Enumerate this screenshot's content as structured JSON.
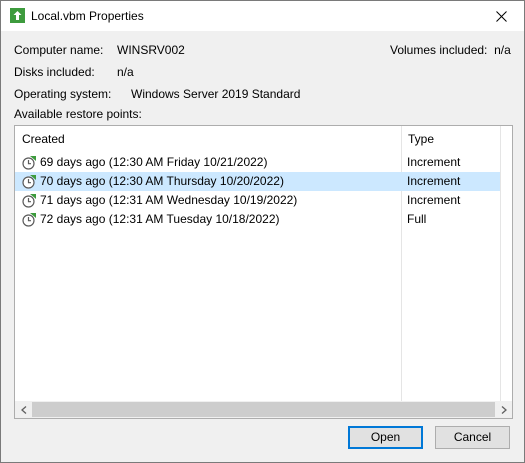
{
  "window": {
    "title": "Local.vbm Properties"
  },
  "info": {
    "computer_name_label": "Computer name:",
    "computer_name_value": "WINSRV002",
    "volumes_label": "Volumes included:",
    "volumes_value": "n/a",
    "disks_label": "Disks included:",
    "disks_value": "n/a",
    "os_label": "Operating system:",
    "os_value": "Windows Server 2019 Standard",
    "restore_points_label": "Available restore points:"
  },
  "table": {
    "columns": [
      "Created",
      "Type"
    ],
    "rows": [
      {
        "created": "69 days ago (12:30 AM Friday 10/21/2022)",
        "type": "Increment",
        "selected": false
      },
      {
        "created": "70 days ago (12:30 AM Thursday 10/20/2022)",
        "type": "Increment",
        "selected": true
      },
      {
        "created": "71 days ago (12:31 AM Wednesday 10/19/2022)",
        "type": "Increment",
        "selected": false
      },
      {
        "created": "72 days ago (12:31 AM Tuesday 10/18/2022)",
        "type": "Full",
        "selected": false
      }
    ]
  },
  "buttons": {
    "open": "Open",
    "cancel": "Cancel"
  },
  "icons": {
    "app": "veeam-app-icon",
    "row": "restore-point-icon",
    "close": "close-icon"
  },
  "colors": {
    "selection": "#cce8ff",
    "default_button_border": "#0078d7",
    "icon_green": "#3d9b3d"
  }
}
